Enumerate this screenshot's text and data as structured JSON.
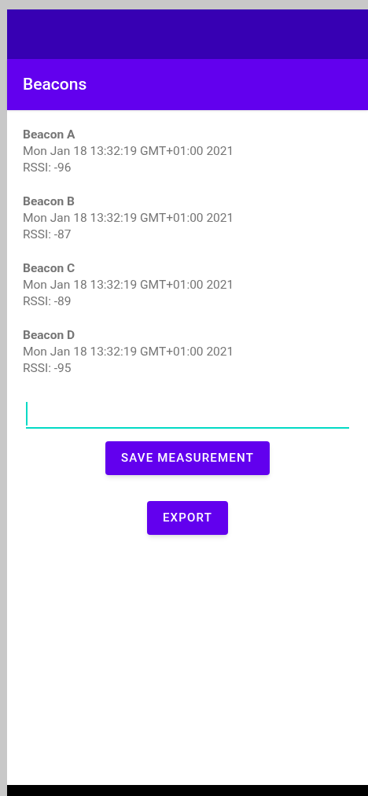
{
  "app_bar": {
    "title": "Beacons"
  },
  "beacons": [
    {
      "name": "Beacon A",
      "time": "Mon Jan 18 13:32:19 GMT+01:00 2021",
      "rssi": "RSSI: -96"
    },
    {
      "name": "Beacon B",
      "time": "Mon Jan 18 13:32:19 GMT+01:00 2021",
      "rssi": "RSSI: -87"
    },
    {
      "name": "Beacon C",
      "time": "Mon Jan 18 13:32:19 GMT+01:00 2021",
      "rssi": "RSSI: -89"
    },
    {
      "name": "Beacon D",
      "time": "Mon Jan 18 13:32:19 GMT+01:00 2021",
      "rssi": "RSSI: -95"
    }
  ],
  "input": {
    "focused": true
  },
  "buttons": [
    "SAVE MEASUREMENT",
    "EXPORT"
  ]
}
